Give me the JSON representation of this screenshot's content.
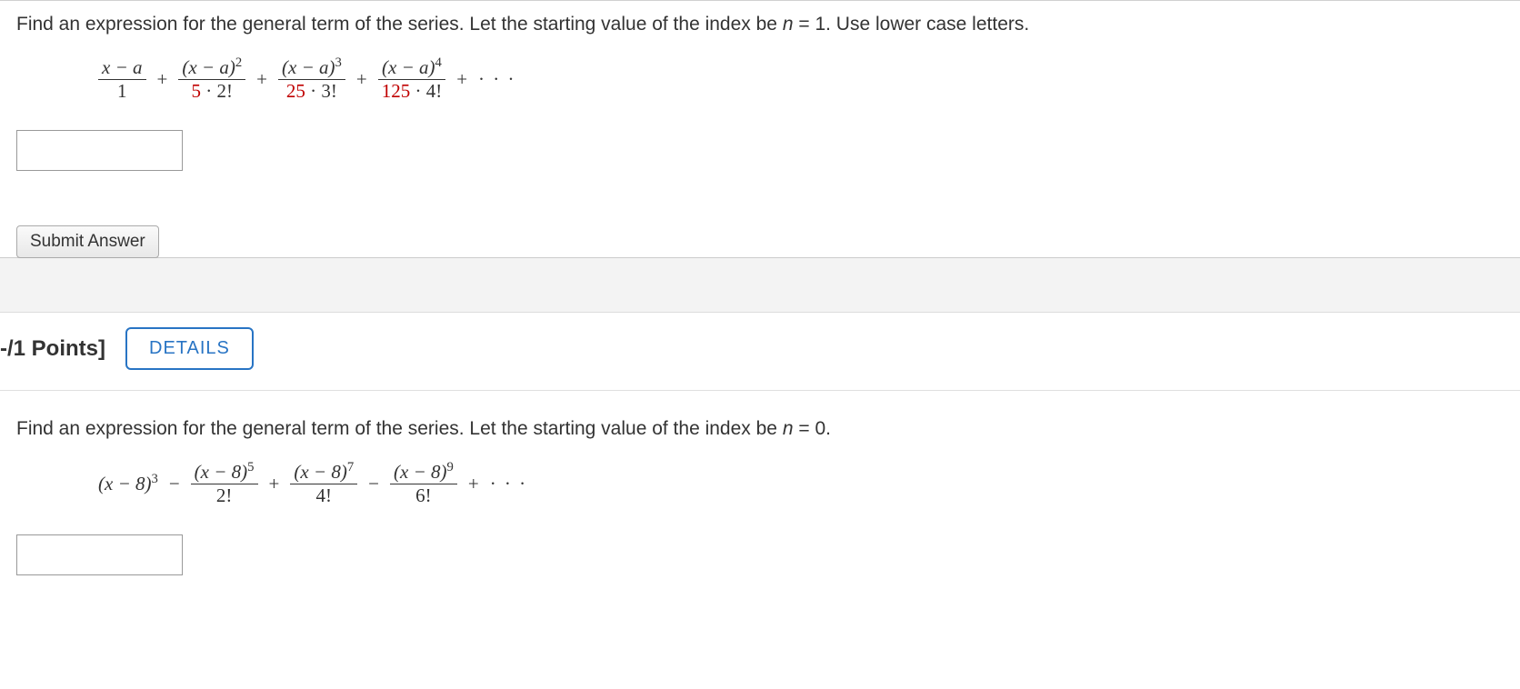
{
  "q1": {
    "prompt_before": "Find an expression for the general term of the series. Let the starting value of the index be ",
    "prompt_var": "n",
    "prompt_after": " = 1. Use lower case letters.",
    "t1_num": "x − a",
    "t1_den": "1",
    "t2_num_base": "(x − a)",
    "t2_num_exp": "2",
    "t2_den_a": "5",
    "t2_den_b": "2!",
    "t3_num_base": "(x − a)",
    "t3_num_exp": "3",
    "t3_den_a": "25",
    "t3_den_b": "3!",
    "t4_num_base": "(x − a)",
    "t4_num_exp": "4",
    "t4_den_a": "125",
    "t4_den_b": "4!",
    "plus": "+",
    "dot": "·",
    "dots": "· · ·"
  },
  "submit_label": "Submit Answer",
  "points_label": "-/1 Points]",
  "details_label": "DETAILS",
  "q2": {
    "prompt_before": "Find an expression for the general term of the series. Let the starting value of the index be ",
    "prompt_var": "n",
    "prompt_after": " = 0.",
    "t1_base": "(x − 8)",
    "t1_exp": "3",
    "t2_num_base": "(x − 8)",
    "t2_num_exp": "5",
    "t2_den": "2!",
    "t3_num_base": "(x − 8)",
    "t3_num_exp": "7",
    "t3_den": "4!",
    "t4_num_base": "(x − 8)",
    "t4_num_exp": "9",
    "t4_den": "6!",
    "plus": "+",
    "minus": "−",
    "dots": "· · ·"
  }
}
